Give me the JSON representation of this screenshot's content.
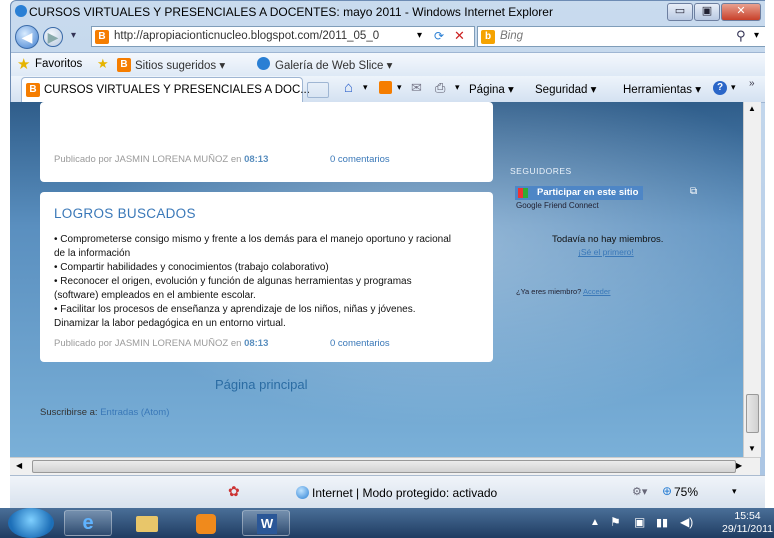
{
  "window": {
    "title": "CURSOS VIRTUALES Y PRESENCIALES A DOCENTES: mayo 2011 - Windows Internet Explorer",
    "minimize_glyph": "▭",
    "maximize_glyph": "▣",
    "close_glyph": "✕"
  },
  "address": {
    "url": "http://apropiacionticnucleo.blogspot.com/2011_05_0",
    "search_placeholder": "Bing"
  },
  "favorites_bar": {
    "favorites_label": "Favoritos",
    "suggested_sites": "Sitios sugeridos ▾",
    "web_slice": "Galería de Web Slice ▾"
  },
  "tab": {
    "label": "CURSOS VIRTUALES Y PRESENCIALES A DOC..."
  },
  "command_bar": {
    "pagina": "Página ▾",
    "seguridad": "Seguridad ▾",
    "herramientas": "Herramientas ▾"
  },
  "posts": {
    "top": {
      "meta_prefix": "Publicado por JASMIN LORENA MUÑOZ en",
      "time": "08:13",
      "comments": "0 comentarios"
    },
    "main": {
      "title": "LOGROS BUSCADOS",
      "lines": [
        "• Comprometerse consigo mismo y frente a los demás para el manejo oportuno y racional",
        "de la información",
        "• Compartir habilidades y conocimientos (trabajo colaborativo)",
        "• Reconocer el origen, evolución y función de algunas herramientas y programas",
        "(software) empleados en el ambiente escolar.",
        "• Facilitar los procesos de enseñanza y aprendizaje de los niños, niñas y jóvenes.",
        "Dinamizar la labor pedagógica en un entorno virtual."
      ],
      "meta_prefix": "Publicado por JASMIN LORENA MUÑOZ en",
      "time": "08:13",
      "comments": "0 comentarios"
    }
  },
  "footer": {
    "pagina_principal": "Página principal",
    "suscribirse_prefix": "Suscribirse a:",
    "suscribirse_link": "Entradas (Atom)"
  },
  "sidebar": {
    "seguidores": "SEGUIDORES",
    "participar": "Participar en este sitio",
    "gfc": "Google Friend Connect",
    "no_miembros": "Todavía no hay miembros.",
    "se_primero": "¡Sé el primero!",
    "ya_miembro": "¿Ya eres miembro?",
    "acceder": "Acceder"
  },
  "statusbar": {
    "status": "Internet | Modo protegido: activado",
    "zoom": "75%"
  },
  "taskbar": {
    "time": "15:54",
    "date": "29/11/2011"
  },
  "colors": {
    "accent": "#3a78b8",
    "blogger": "#f57d00"
  }
}
